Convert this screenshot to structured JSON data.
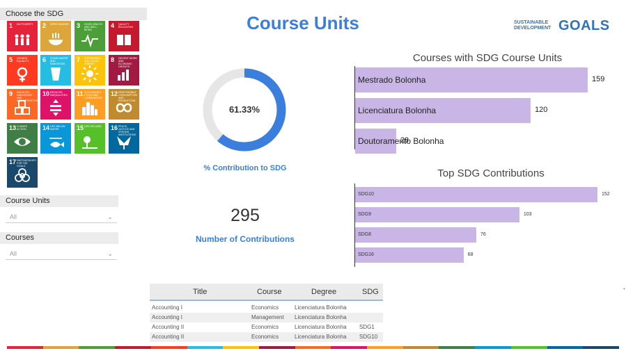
{
  "sidebar": {
    "sdg_header": "Choose the SDG",
    "tiles": [
      {
        "num": "1",
        "caption": "No poverty",
        "color": "#e5243b",
        "icon": "people-icon"
      },
      {
        "num": "2",
        "caption": "Zero hunger",
        "color": "#dda63a",
        "icon": "bowl-icon"
      },
      {
        "num": "3",
        "caption": "Good health and well-being",
        "color": "#4c9f38",
        "icon": "heartbeat-icon"
      },
      {
        "num": "4",
        "caption": "Quality education",
        "color": "#c5192d",
        "icon": "book-icon"
      },
      {
        "num": "5",
        "caption": "Gender equality",
        "color": "#ff3a21",
        "icon": "gender-icon"
      },
      {
        "num": "6",
        "caption": "Clean water and sanitation",
        "color": "#26bde2",
        "icon": "water-icon"
      },
      {
        "num": "7",
        "caption": "Affordable and clean energy",
        "color": "#fcc30b",
        "icon": "sun-icon"
      },
      {
        "num": "8",
        "caption": "Decent work and economic growth",
        "color": "#a21942",
        "icon": "growth-icon"
      },
      {
        "num": "9",
        "caption": "Industry, innovation and infrastructure",
        "color": "#fd6925",
        "icon": "cubes-icon"
      },
      {
        "num": "10",
        "caption": "Reduced inequalities",
        "color": "#dd1367",
        "icon": "equality-icon"
      },
      {
        "num": "11",
        "caption": "Sustainable cities and communities",
        "color": "#fd9d24",
        "icon": "city-icon"
      },
      {
        "num": "12",
        "caption": "Responsible consumption and production",
        "color": "#bf8b2e",
        "icon": "infinity-icon"
      },
      {
        "num": "13",
        "caption": "Climate action",
        "color": "#3f7e44",
        "icon": "eye-globe-icon"
      },
      {
        "num": "14",
        "caption": "Life below water",
        "color": "#0a97d9",
        "icon": "fish-icon"
      },
      {
        "num": "15",
        "caption": "Life on land",
        "color": "#56c02b",
        "icon": "tree-icon"
      },
      {
        "num": "16",
        "caption": "Peace, justice and strong institutions",
        "color": "#00689d",
        "icon": "dove-icon"
      },
      {
        "num": "17",
        "caption": "Partnerships for the goals",
        "color": "#19486a",
        "icon": "rings-icon"
      }
    ],
    "filters": [
      {
        "label": "Course Units",
        "value": "All"
      },
      {
        "label": "Courses",
        "value": "All"
      }
    ]
  },
  "header": {
    "title": "Course Units",
    "logo_small": "SUSTAINABLE DEVELOPMENT",
    "logo_big": "GOALS"
  },
  "donut": {
    "value_text": "61.33%",
    "fraction": 0.6133,
    "label": "% Contribution to SDG",
    "fill_color": "#3a7fde",
    "track_color": "#e6e6e6"
  },
  "kpi": {
    "value": "295",
    "label": "Number of  Contributions"
  },
  "chart_data": [
    {
      "type": "bar",
      "orientation": "horizontal",
      "title": "Courses with SDG Course Units",
      "categories": [
        "Mestrado Bolonha",
        "Licenciatura Bolonha",
        "Doutoramento Bolonha"
      ],
      "values": [
        159,
        120,
        28
      ],
      "value_labels": [
        "159",
        "120",
        "28"
      ],
      "xlim": [
        0,
        159
      ],
      "grid": false,
      "color": "#c9b6e6"
    },
    {
      "type": "bar",
      "orientation": "horizontal",
      "title": "Top SDG Contributions",
      "categories": [
        "SDG10",
        "SDG9",
        "SDG8",
        "SDG16"
      ],
      "values": [
        152,
        103,
        76,
        68
      ],
      "value_labels": [
        "152",
        "103",
        "76",
        "68"
      ],
      "xlim": [
        0,
        152
      ],
      "grid": false,
      "color": "#c9b6e6"
    }
  ],
  "table": {
    "columns": [
      "Title",
      "Course",
      "Degree",
      "SDG"
    ],
    "rows": [
      [
        "Accounting I",
        "Economics",
        "Licenciatura Bolonha",
        ""
      ],
      [
        "Accounting I",
        "Management",
        "Licenciatura Bolonha",
        ""
      ],
      [
        "Accounting II",
        "Economics",
        "Licenciatura Bolonha",
        "SDG1"
      ],
      [
        "Accounting II",
        "Economics",
        "Licenciatura Bolonha",
        "SDG10"
      ]
    ]
  },
  "footer": {
    "stripe_colors": [
      "#e5243b",
      "#dda63a",
      "#4c9f38",
      "#c5192d",
      "#ff3a21",
      "#26bde2",
      "#fcc30b",
      "#a21942",
      "#fd6925",
      "#dd1367",
      "#fd9d24",
      "#bf8b2e",
      "#3f7e44",
      "#0a97d9",
      "#56c02b",
      "#00689d",
      "#19486a"
    ],
    "corner_mark": "•"
  }
}
